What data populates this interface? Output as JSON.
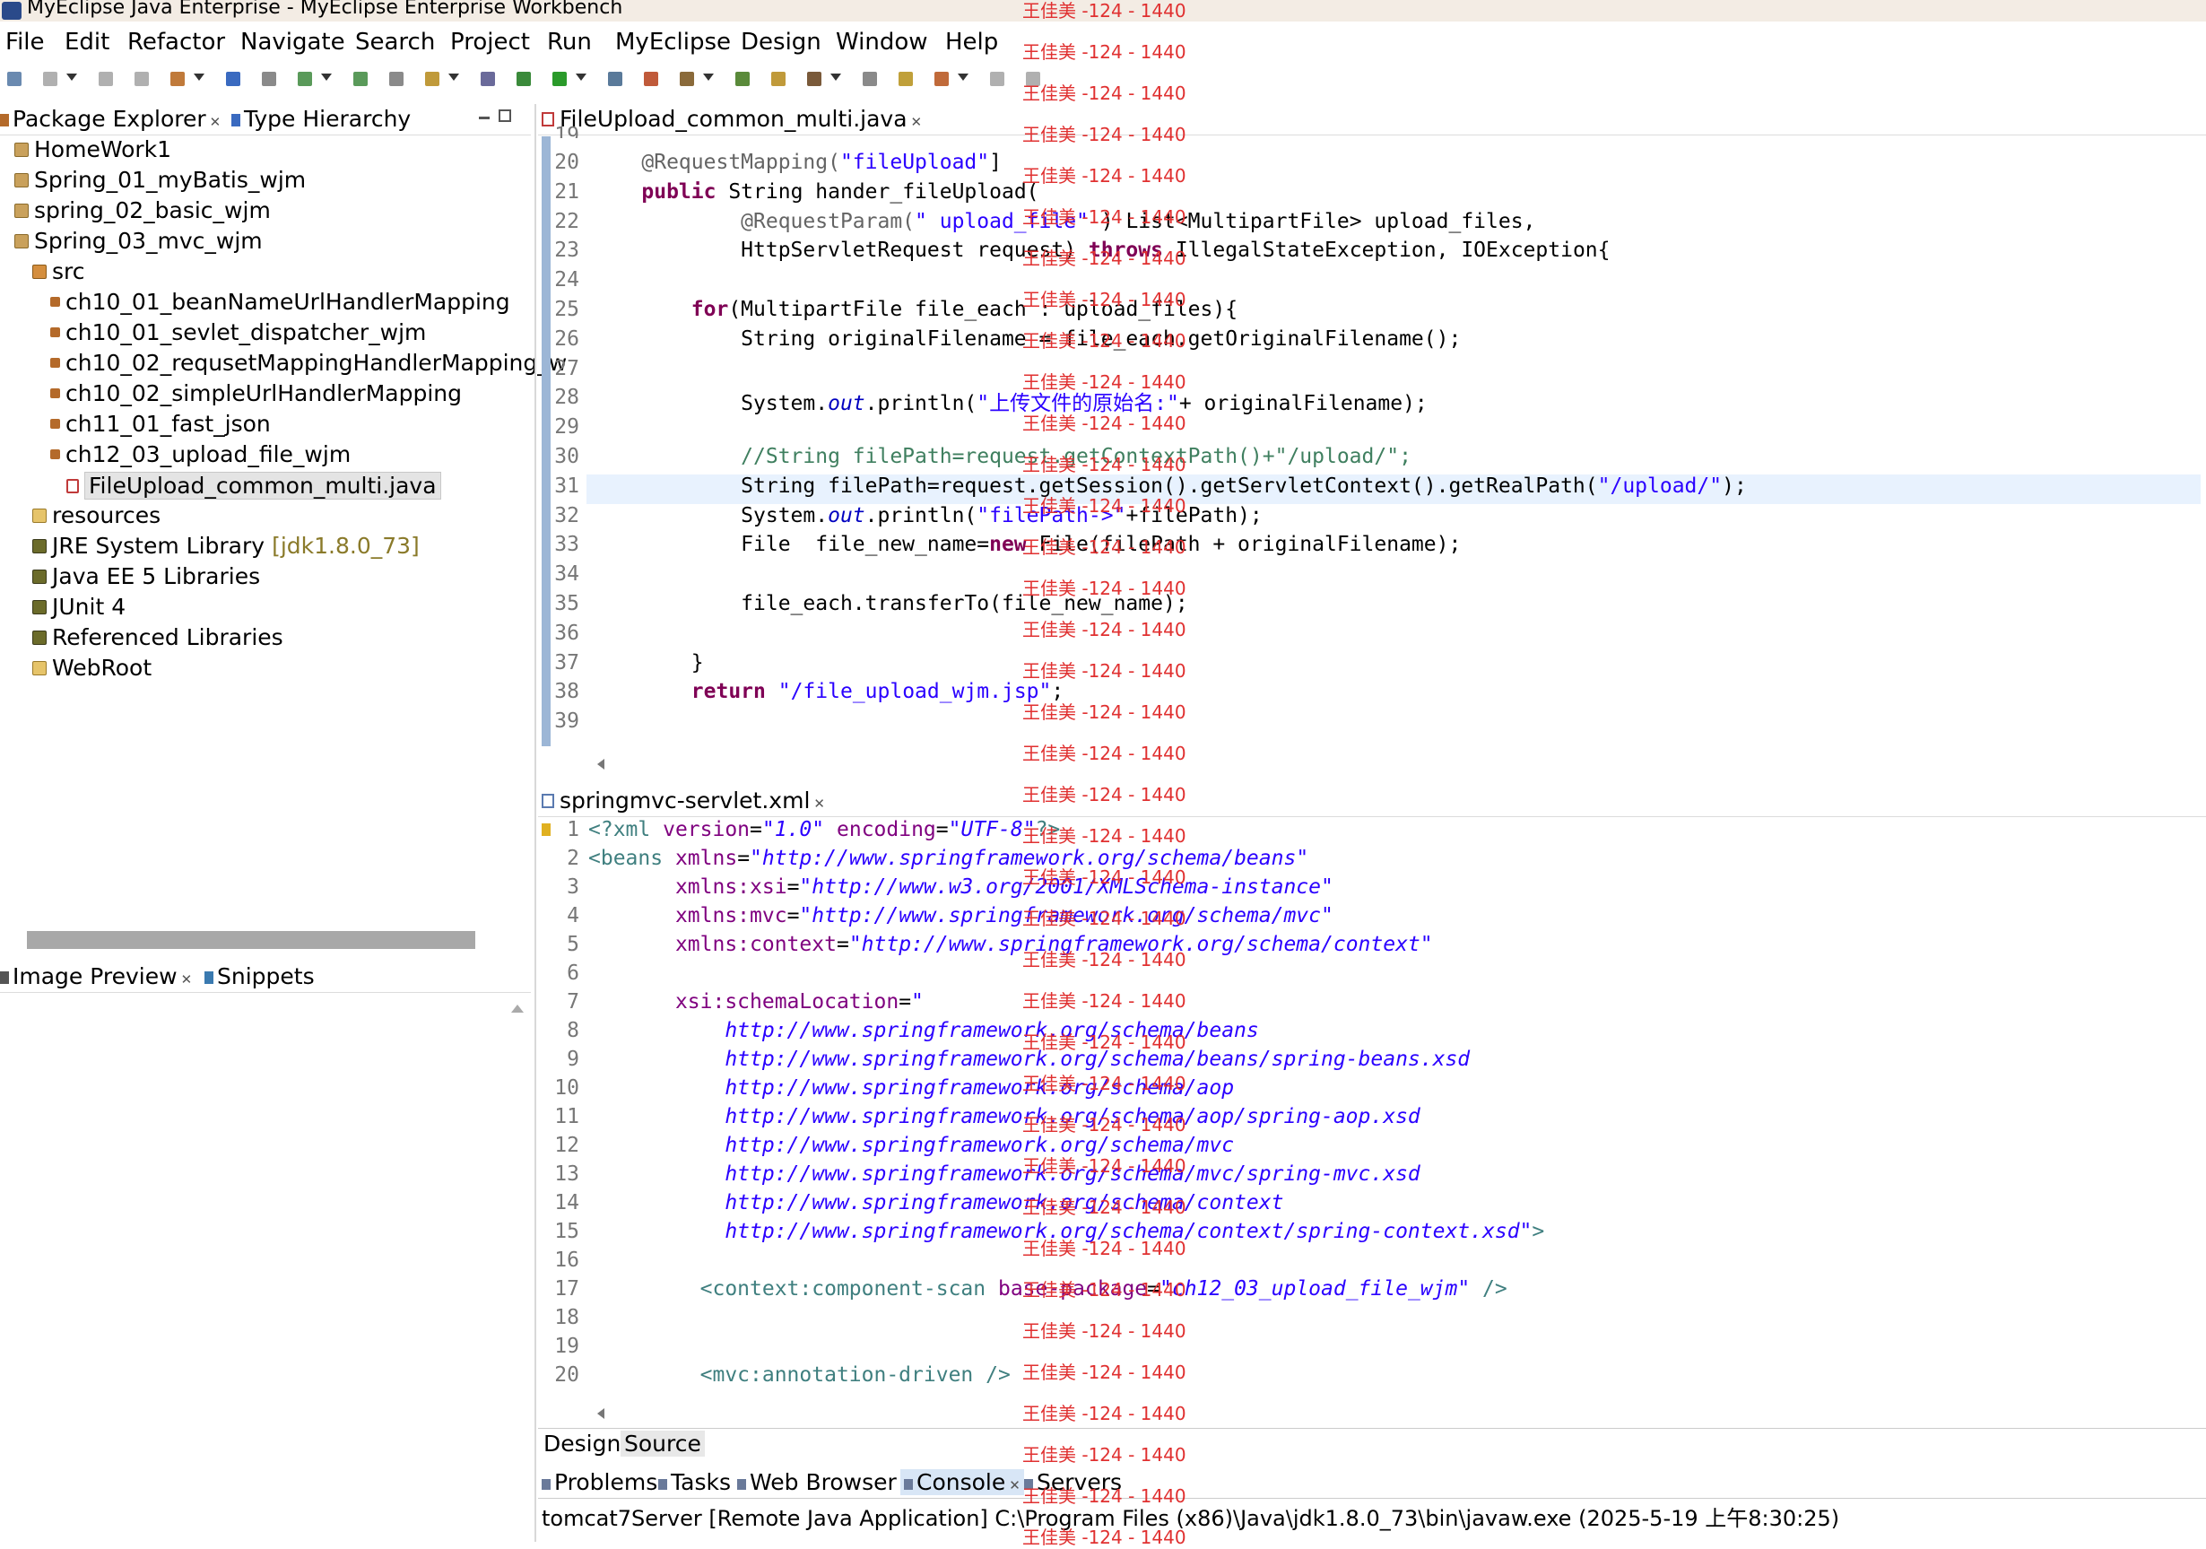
{
  "window": {
    "title": "MyEclipse Java Enterprise - MyEclipse Enterprise Workbench"
  },
  "menu": [
    "File",
    "Edit",
    "Refactor",
    "Navigate",
    "Search",
    "Project",
    "Run",
    "MyEclipse",
    "Design",
    "Window",
    "Help"
  ],
  "left_top": {
    "tabs": [
      {
        "label": "Package Explorer"
      },
      {
        "label": "Type Hierarchy"
      }
    ],
    "tree": [
      {
        "label": "HomeWork1",
        "level": 0,
        "icon": "project-icon"
      },
      {
        "label": "Spring_01_myBatis_wjm",
        "level": 0,
        "icon": "project-icon"
      },
      {
        "label": "spring_02_basic_wjm",
        "level": 0,
        "icon": "project-icon"
      },
      {
        "label": "Spring_03_mvc_wjm",
        "level": 0,
        "icon": "project-icon"
      },
      {
        "label": "src",
        "level": 1,
        "icon": "source-folder-icon"
      },
      {
        "label": "ch10_01_beanNameUrlHandlerMapping",
        "level": 2,
        "icon": "package-icon"
      },
      {
        "label": "ch10_01_sevlet_dispatcher_wjm",
        "level": 2,
        "icon": "package-icon"
      },
      {
        "label": "ch10_02_requsetMappingHandlerMapping_w",
        "level": 2,
        "icon": "package-icon"
      },
      {
        "label": "ch10_02_simpleUrlHandlerMapping",
        "level": 2,
        "icon": "package-icon"
      },
      {
        "label": "ch11_01_fast_json",
        "level": 2,
        "icon": "package-icon"
      },
      {
        "label": "ch12_03_upload_file_wjm",
        "level": 2,
        "icon": "package-icon"
      },
      {
        "label": "FileUpload_common_multi.java",
        "level": 3,
        "icon": "java-file-icon",
        "selected": true
      },
      {
        "label": "resources",
        "level": 1,
        "icon": "folder-icon"
      },
      {
        "label": "JRE System Library",
        "decor": "[jdk1.8.0_73]",
        "level": 1,
        "icon": "library-icon"
      },
      {
        "label": "Java EE 5 Libraries",
        "level": 1,
        "icon": "library-icon"
      },
      {
        "label": "JUnit 4",
        "level": 1,
        "icon": "library-icon"
      },
      {
        "label": "Referenced Libraries",
        "level": 1,
        "icon": "library-icon"
      },
      {
        "label": "WebRoot",
        "level": 1,
        "icon": "folder-icon"
      }
    ]
  },
  "left_bottom": {
    "tabs": [
      {
        "label": "Image Preview"
      },
      {
        "label": "Snippets"
      }
    ]
  },
  "editor_top": {
    "tab": "FileUpload_common_multi.java",
    "partial_line": "19",
    "lines": [
      {
        "n": "20",
        "segs": [
          [
            "ann",
            "    @RequestMapping("
          ],
          [
            "str",
            "\"fileUpload\""
          ],
          [
            "",
            "]"
          ]
        ]
      },
      {
        "n": "21",
        "segs": [
          [
            "",
            "    "
          ],
          [
            "kw",
            "public"
          ],
          [
            "",
            " String hander_fileUpload("
          ]
        ]
      },
      {
        "n": "22",
        "segs": [
          [
            "ann",
            "            @RequestParam("
          ],
          [
            "str",
            "\" upload_file\""
          ],
          [
            "",
            " ) List<MultipartFile> upload_files,"
          ]
        ]
      },
      {
        "n": "23",
        "segs": [
          [
            "",
            "            HttpServletRequest request) "
          ],
          [
            "kw",
            "throws"
          ],
          [
            "",
            " IllegalStateException, IOException{"
          ]
        ]
      },
      {
        "n": "24",
        "segs": []
      },
      {
        "n": "25",
        "segs": [
          [
            "",
            "        "
          ],
          [
            "kw",
            "for"
          ],
          [
            "",
            "(MultipartFile file_each : upload_files){"
          ]
        ]
      },
      {
        "n": "26",
        "segs": [
          [
            "",
            "            String originalFilename = file_each.getOriginalFilename();"
          ]
        ]
      },
      {
        "n": "27",
        "segs": []
      },
      {
        "n": "28",
        "segs": [
          [
            "",
            "            System."
          ],
          [
            "it",
            "out"
          ],
          [
            "",
            ".println("
          ],
          [
            "str",
            "\"上传文件的原始名:\""
          ],
          [
            "",
            "+ originalFilename);"
          ]
        ]
      },
      {
        "n": "29",
        "segs": []
      },
      {
        "n": "30",
        "segs": [
          [
            "cm",
            "            //String filePath=request.getContextPath()+\"/upload/\";"
          ]
        ]
      },
      {
        "n": "31",
        "segs": [
          [
            "",
            "            String filePath=request.getSession().getServletContext().getRealPath("
          ],
          [
            "str",
            "\"/upload/\""
          ],
          [
            "",
            ");"
          ]
        ],
        "current": true
      },
      {
        "n": "32",
        "segs": [
          [
            "",
            "            System."
          ],
          [
            "it",
            "out"
          ],
          [
            "",
            ".println("
          ],
          [
            "str",
            "\"filePath->\""
          ],
          [
            "",
            "+filePath);"
          ]
        ]
      },
      {
        "n": "33",
        "segs": [
          [
            "",
            "            File  file_new_name="
          ],
          [
            "kw",
            "new"
          ],
          [
            "",
            " File(filePath + originalFilename);"
          ]
        ]
      },
      {
        "n": "34",
        "segs": []
      },
      {
        "n": "35",
        "segs": [
          [
            "",
            "            file_each.transferTo(file_new_name);"
          ]
        ]
      },
      {
        "n": "36",
        "segs": []
      },
      {
        "n": "37",
        "segs": [
          [
            "",
            "        }"
          ]
        ]
      },
      {
        "n": "38",
        "segs": [
          [
            "",
            "        "
          ],
          [
            "kw",
            "return"
          ],
          [
            "",
            " "
          ],
          [
            "str",
            "\"/file_upload_wjm.jsp\""
          ],
          [
            "",
            ";"
          ]
        ]
      },
      {
        "n": "39",
        "segs": []
      }
    ]
  },
  "editor_bottom": {
    "tab": "springmvc-servlet.xml",
    "bottom_tabs": [
      "Design",
      "Source"
    ],
    "lines": [
      {
        "n": "1",
        "segs": [
          [
            "xtag",
            "<?xml "
          ],
          [
            "xattr",
            "version"
          ],
          [
            "",
            "="
          ],
          [
            "xval",
            "\"1.0\""
          ],
          [
            "",
            " "
          ],
          [
            "xattr",
            "encoding"
          ],
          [
            "",
            "="
          ],
          [
            "xval",
            "\"UTF-8\""
          ],
          [
            "xtag",
            "?>"
          ]
        ]
      },
      {
        "n": "2",
        "segs": [
          [
            "xtag",
            "<beans "
          ],
          [
            "xattr",
            "xmlns"
          ],
          [
            "",
            "="
          ],
          [
            "xval",
            "\"http://www.springframework.org/schema/beans\""
          ]
        ]
      },
      {
        "n": "3",
        "segs": [
          [
            "",
            "       "
          ],
          [
            "xattr",
            "xmlns:xsi"
          ],
          [
            "",
            "="
          ],
          [
            "xval",
            "\"http://www.w3.org/2001/XMLSchema-instance\""
          ]
        ]
      },
      {
        "n": "4",
        "segs": [
          [
            "",
            "       "
          ],
          [
            "xattr",
            "xmlns:mvc"
          ],
          [
            "",
            "="
          ],
          [
            "xval",
            "\"http://www.springframework.org/schema/mvc\""
          ]
        ]
      },
      {
        "n": "5",
        "segs": [
          [
            "",
            "       "
          ],
          [
            "xattr",
            "xmlns:context"
          ],
          [
            "",
            "="
          ],
          [
            "xval",
            "\"http://www.springframework.org/schema/context\""
          ]
        ]
      },
      {
        "n": "6",
        "segs": []
      },
      {
        "n": "7",
        "segs": [
          [
            "",
            "       "
          ],
          [
            "xattr",
            "xsi:schemaLocation"
          ],
          [
            "",
            "="
          ],
          [
            "xval",
            "\""
          ]
        ]
      },
      {
        "n": "8",
        "segs": [
          [
            "xval",
            "           http://www.springframework.org/schema/beans"
          ]
        ]
      },
      {
        "n": "9",
        "segs": [
          [
            "xval",
            "           http://www.springframework.org/schema/beans/spring-beans.xsd"
          ]
        ]
      },
      {
        "n": "10",
        "segs": [
          [
            "xval",
            "           http://www.springframework.org/schema/aop"
          ]
        ]
      },
      {
        "n": "11",
        "segs": [
          [
            "xval",
            "           http://www.springframework.org/schema/aop/spring-aop.xsd"
          ]
        ]
      },
      {
        "n": "12",
        "segs": [
          [
            "xval",
            "           http://www.springframework.org/schema/mvc"
          ]
        ]
      },
      {
        "n": "13",
        "segs": [
          [
            "xval",
            "           http://www.springframework.org/schema/mvc/spring-mvc.xsd"
          ]
        ]
      },
      {
        "n": "14",
        "segs": [
          [
            "xval",
            "           http://www.springframework.org/schema/context"
          ]
        ]
      },
      {
        "n": "15",
        "segs": [
          [
            "xval",
            "           http://www.springframework.org/schema/context/spring-context.xsd\""
          ],
          [
            "xtag",
            ">"
          ]
        ]
      },
      {
        "n": "16",
        "segs": []
      },
      {
        "n": "17",
        "segs": [
          [
            "xtag",
            "         <context:component-scan "
          ],
          [
            "xattr",
            "base-package"
          ],
          [
            "",
            "="
          ],
          [
            "xval",
            "\"ch12_03_upload_file_wjm\""
          ],
          [
            "xtag",
            " />"
          ]
        ]
      },
      {
        "n": "18",
        "segs": []
      },
      {
        "n": "19",
        "segs": []
      },
      {
        "n": "20",
        "segs": [
          [
            "xtag",
            "         <mvc:annotation-driven />"
          ]
        ]
      }
    ]
  },
  "bottom_panel": {
    "tabs": [
      {
        "label": "Problems"
      },
      {
        "label": "Tasks"
      },
      {
        "label": "Web Browser"
      },
      {
        "label": "Console",
        "active": true
      },
      {
        "label": "Servers"
      }
    ],
    "console_header": "tomcat7Server [Remote Java Application] C:\\Program Files (x86)\\Java\\jdk1.8.0_73\\bin\\javaw.exe (2025-5-19 上午8:30:25)"
  },
  "watermark": "王佳美 -124 - 1440",
  "colors": {
    "keyword": "#7f0055",
    "string": "#2a00ff",
    "annotation": "#646464",
    "comment": "#3f7f5f",
    "field": "#0000c0",
    "xml_tag": "#3f7f7f",
    "xml_attr": "#7f007f",
    "watermark": "#e03030"
  }
}
